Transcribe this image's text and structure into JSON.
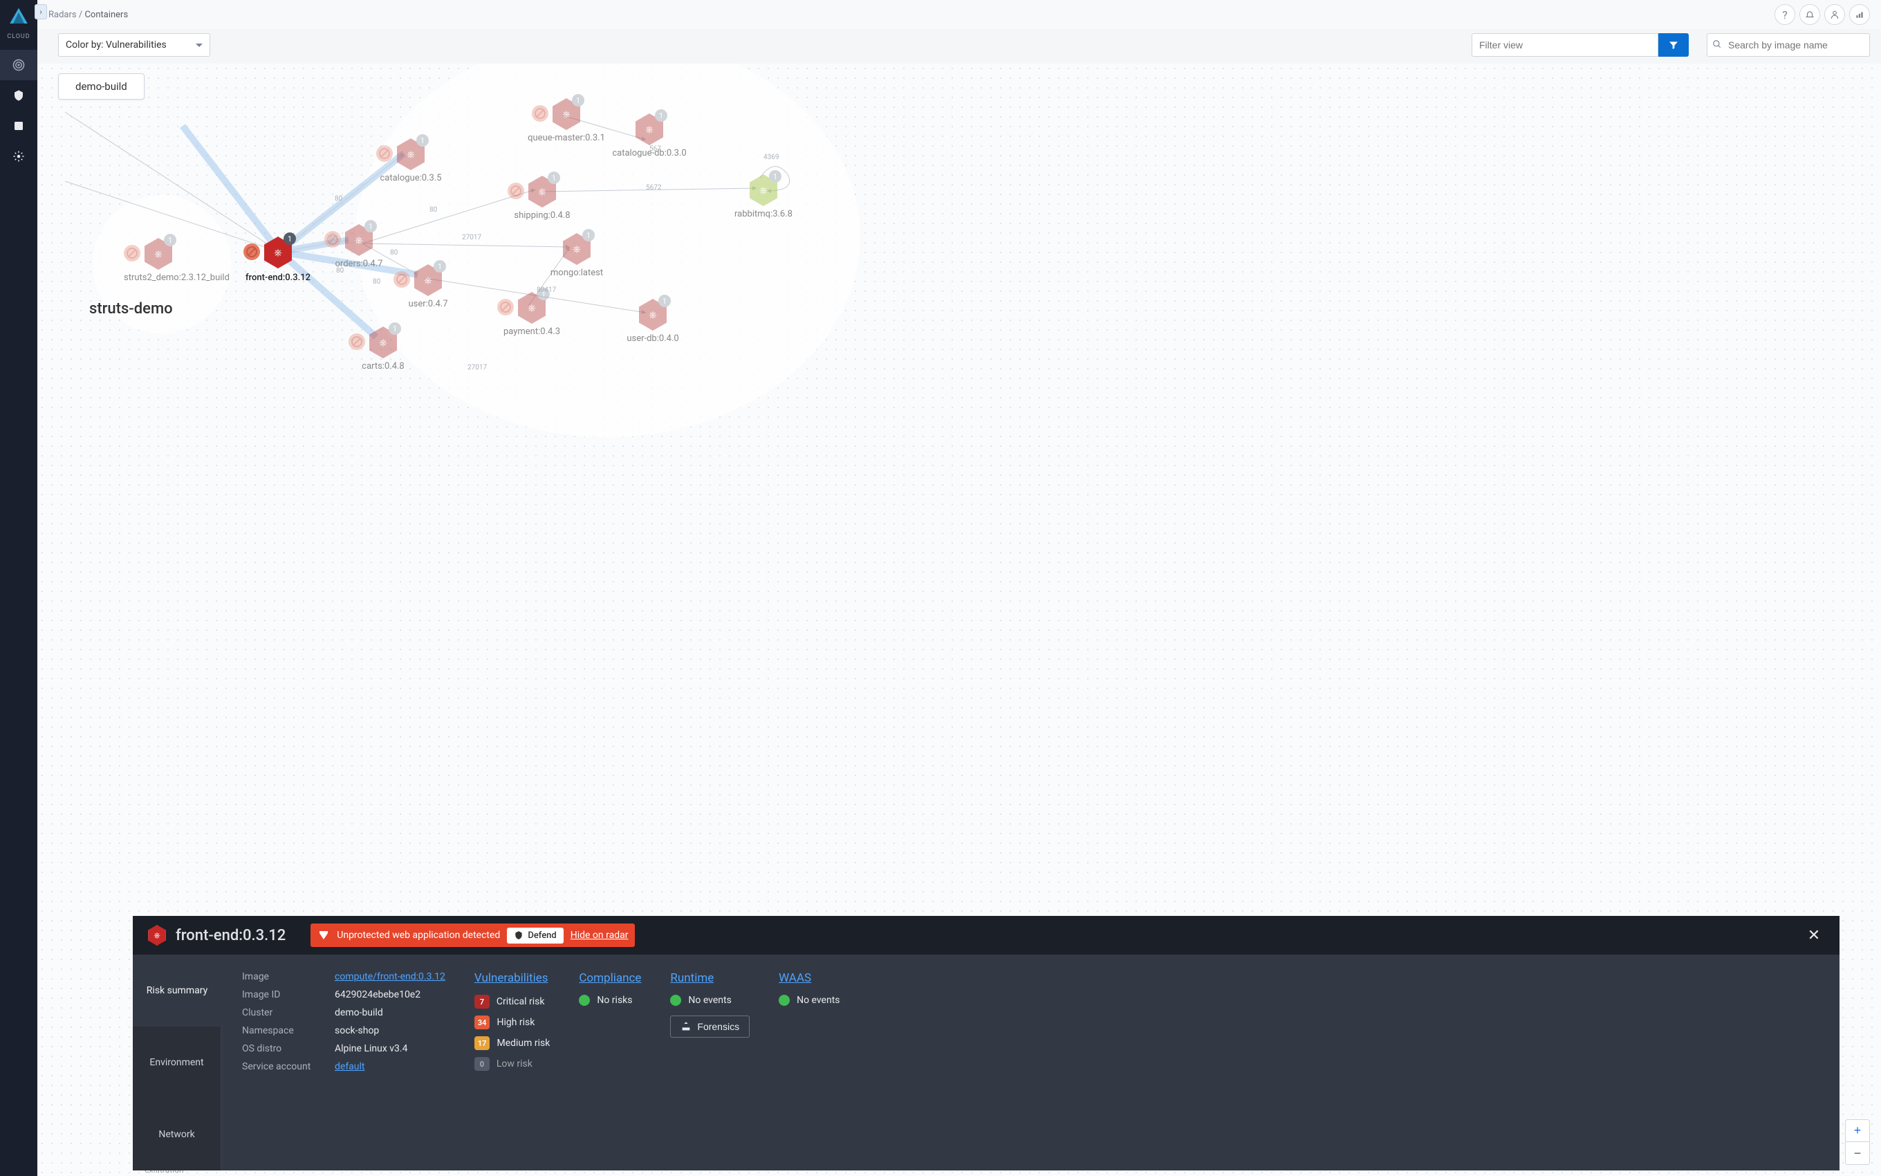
{
  "brand": "CLOUD",
  "breadcrumb": {
    "parent": "Radars",
    "current": "Containers"
  },
  "color_select": "Color by: Vulnerabilities",
  "filter_placeholder": "Filter view",
  "search_placeholder": "Search by image name",
  "cluster_labels": {
    "demo_build": "demo-build",
    "struts_demo": "struts-demo"
  },
  "nodes": {
    "queue_master": {
      "label": "queue-master:0.3.1",
      "badge": "1"
    },
    "catalogue_db": {
      "label": "catalogue-db:0.3.0",
      "badge": "1"
    },
    "catalogue": {
      "label": "catalogue:0.3.5",
      "badge": "1"
    },
    "shipping": {
      "label": "shipping:0.4.8",
      "badge": "1"
    },
    "rabbitmq": {
      "label": "rabbitmq:3.6.8",
      "badge": "1"
    },
    "orders": {
      "label": "orders:0.4.7",
      "badge": "1"
    },
    "mongo": {
      "label": "mongo:latest",
      "badge": "1"
    },
    "user": {
      "label": "user:0.4.7",
      "badge": "1"
    },
    "payment": {
      "label": "payment:0.4.3",
      "badge": "1"
    },
    "user_db": {
      "label": "user-db:0.4.0",
      "badge": "1"
    },
    "carts": {
      "label": "carts:0.4.8",
      "badge": "1"
    },
    "struts2": {
      "label": "struts2_demo:2.3.12_build",
      "badge": "1"
    },
    "front_end": {
      "label": "front-end:0.3.12",
      "badge": "1"
    },
    "exfiltration": {
      "label": "exfiltration-"
    }
  },
  "edge_labels": {
    "e1": "80",
    "e2": "567",
    "e3": "5672",
    "e4": "4369",
    "e5": "27017",
    "e6": "80",
    "e7": "80",
    "e8": "80",
    "e9": "80",
    "e10": "80",
    "e11": "27017",
    "e12": "80417"
  },
  "panel": {
    "title": "front-end:0.3.12",
    "alert_text": "Unprotected web application detected",
    "defend": "Defend",
    "hide": "Hide on radar",
    "tabs": {
      "risk": "Risk summary",
      "env": "Environment",
      "net": "Network"
    },
    "kv": {
      "image_k": "Image",
      "image_v": "compute/front-end:0.3.12",
      "imageid_k": "Image ID",
      "imageid_v": "6429024ebebe10e2",
      "cluster_k": "Cluster",
      "cluster_v": "demo-build",
      "ns_k": "Namespace",
      "ns_v": "sock-shop",
      "os_k": "OS distro",
      "os_v": "Alpine Linux v3.4",
      "sa_k": "Service account",
      "sa_v": "default"
    },
    "vuln": {
      "heading": "Vulnerabilities",
      "crit_n": "7",
      "crit_l": "Critical risk",
      "high_n": "34",
      "high_l": "High risk",
      "med_n": "17",
      "med_l": "Medium risk",
      "low_n": "0",
      "low_l": "Low risk"
    },
    "compliance": {
      "heading": "Compliance",
      "status": "No risks"
    },
    "runtime": {
      "heading": "Runtime",
      "status": "No events",
      "forensics": "Forensics"
    },
    "waas": {
      "heading": "WAAS",
      "status": "No events"
    }
  }
}
